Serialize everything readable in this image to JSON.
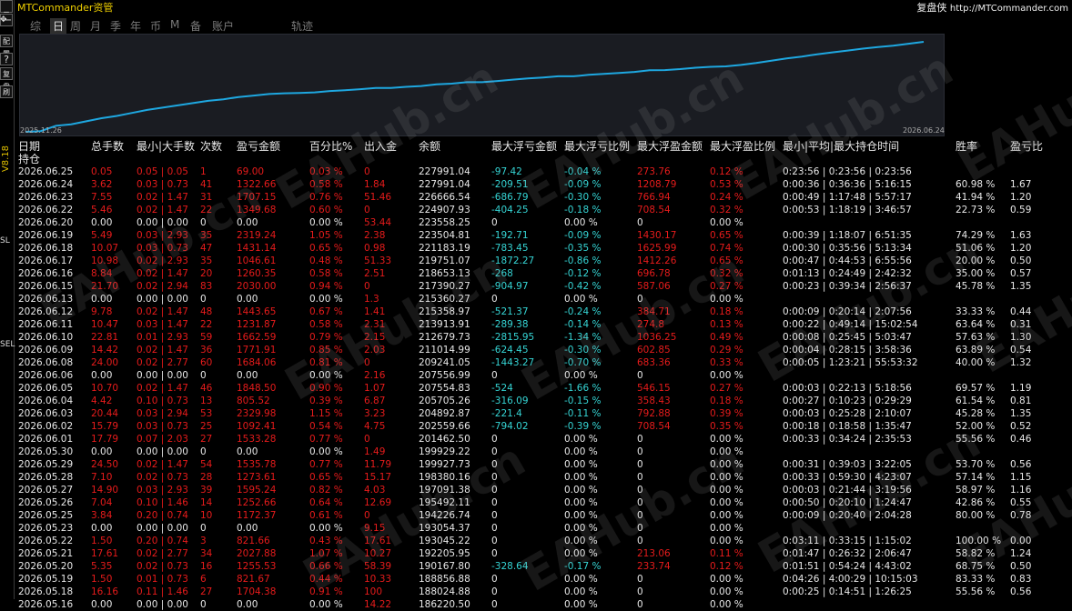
{
  "app": {
    "title": "MTCommander资管",
    "brand": "复盘侠",
    "url": "http://MTCommander.com",
    "version": "V8.18"
  },
  "left_toolbar": [
    "_",
    "一",
    "✥",
    "配置",
    "?",
    "复盘",
    "刷",
    "SL",
    "SEL"
  ],
  "tabs": [
    {
      "label": "综",
      "active": false
    },
    {
      "label": "日",
      "active": true
    },
    {
      "label": "周",
      "active": false
    },
    {
      "label": "月",
      "active": false
    },
    {
      "label": "季",
      "active": false
    },
    {
      "label": "年",
      "active": false
    },
    {
      "label": "币",
      "active": false
    },
    {
      "label": "M",
      "active": false
    },
    {
      "label": "备",
      "active": false
    },
    {
      "label": "账户",
      "active": false
    },
    {
      "label": "轨迹",
      "active": false
    }
  ],
  "chart": {
    "start_label": "2025.11.26",
    "end_label": "2026.06.24",
    "line_color": "#1ea7e0",
    "values": [
      142000,
      143000,
      150000,
      152000,
      156000,
      160000,
      163000,
      167000,
      171000,
      174000,
      177000,
      180000,
      183000,
      185000,
      188000,
      190000,
      192000,
      193000,
      193500,
      194200,
      196000,
      197000,
      198400,
      199900,
      199900,
      201500,
      202600,
      204900,
      205700,
      207600,
      207600,
      209200,
      211000,
      212700,
      213900,
      215400,
      215400,
      217400,
      218700,
      219800,
      221200,
      223500,
      223600,
      224900,
      226700,
      227990,
      228500,
      230500,
      233000,
      236000,
      239000,
      241500,
      244500,
      247000,
      249500,
      252000,
      254000,
      256000,
      258500,
      261000
    ]
  },
  "watermark": "EAHub.cn",
  "table": {
    "headers": [
      "日期",
      "总手数",
      "最小|大手数",
      "次数",
      "盈亏金额",
      "百分比%",
      "出入金",
      "余额",
      "最大浮亏金额",
      "最大浮亏比例",
      "最大浮盈金额",
      "最大浮盈比例",
      "最小|平均|最大持仓时间",
      "胜率",
      "盈亏比"
    ],
    "sub_header": "持仓",
    "rows": [
      [
        "2026.06.25",
        "0.05",
        "0.05 | 0.05",
        "1",
        "69.00",
        "0.03 %",
        "0",
        "227991.04",
        "-97.42",
        "-0.04 %",
        "273.76",
        "0.12 %",
        "0:23:56 | 0:23:56 | 0:23:56",
        "",
        ""
      ],
      [
        "2026.06.24",
        "3.62",
        "0.03 | 0.73",
        "41",
        "1322.66",
        "0.58 %",
        "1.84",
        "227991.04",
        "-209.51",
        "-0.09 %",
        "1208.79",
        "0.53 %",
        "0:00:36 | 0:36:36 | 5:16:15",
        "60.98 %",
        "1.67"
      ],
      [
        "2026.06.23",
        "7.55",
        "0.02 | 1.47",
        "31",
        "1707.15",
        "0.76 %",
        "51.46",
        "226666.54",
        "-686.79",
        "-0.30 %",
        "766.94",
        "0.24 %",
        "0:00:49 | 1:17:48 | 5:57:17",
        "41.94 %",
        "1.20"
      ],
      [
        "2026.06.22",
        "5.46",
        "0.02 | 1.47",
        "22",
        "1349.68",
        "0.60 %",
        "0",
        "224907.93",
        "-404.25",
        "-0.18 %",
        "708.54",
        "0.32 %",
        "0:00:53 | 1:18:19 | 3:46:57",
        "22.73 %",
        "0.59"
      ],
      [
        "2026.06.20",
        "0.00",
        "0.00 | 0.00",
        "0",
        "0.00",
        "0.00 %",
        "53.44",
        "223558.25",
        "0",
        "0.00 %",
        "0",
        "0.00 %",
        "",
        "",
        ""
      ],
      [
        "2026.06.19",
        "5.49",
        "0.03 | 2.93",
        "35",
        "2319.24",
        "1.05 %",
        "2.38",
        "223504.81",
        "-192.71",
        "-0.09 %",
        "1430.17",
        "0.65 %",
        "0:00:39 | 1:18:07 | 6:51:35",
        "74.29 %",
        "1.63"
      ],
      [
        "2026.06.18",
        "10.07",
        "0.03 | 0.73",
        "47",
        "1431.14",
        "0.65 %",
        "0.98",
        "221183.19",
        "-783.45",
        "-0.35 %",
        "1625.99",
        "0.74 %",
        "0:00:30 | 0:35:56 | 5:13:34",
        "51.06 %",
        "1.20"
      ],
      [
        "2026.06.17",
        "10.98",
        "0.02 | 2.93",
        "35",
        "1046.61",
        "0.48 %",
        "51.33",
        "219751.07",
        "-1872.27",
        "-0.86 %",
        "1412.26",
        "0.65 %",
        "0:00:47 | 0:44:53 | 6:55:56",
        "20.00 %",
        "0.50"
      ],
      [
        "2026.06.16",
        "8.84",
        "0.02 | 1.47",
        "20",
        "1260.35",
        "0.58 %",
        "2.51",
        "218653.13",
        "-268",
        "-0.12 %",
        "696.78",
        "0.32 %",
        "0:01:13 | 0:24:49 | 2:42:32",
        "35.00 %",
        "0.57"
      ],
      [
        "2026.06.15",
        "21.70",
        "0.02 | 2.94",
        "83",
        "2030.00",
        "0.94 %",
        "0",
        "217390.27",
        "-904.97",
        "-0.42 %",
        "587.06",
        "0.27 %",
        "0:00:23 | 0:39:34 | 2:56:37",
        "45.78 %",
        "1.35"
      ],
      [
        "2026.06.13",
        "0.00",
        "0.00 | 0.00",
        "0",
        "0.00",
        "0.00 %",
        "1.3",
        "215360.27",
        "0",
        "0.00 %",
        "0",
        "0.00 %",
        "",
        "",
        ""
      ],
      [
        "2026.06.12",
        "9.78",
        "0.02 | 1.47",
        "48",
        "1443.65",
        "0.67 %",
        "1.41",
        "215358.97",
        "-521.37",
        "-0.24 %",
        "384.71",
        "0.18 %",
        "0:00:09 | 0:20:14 | 2:07:56",
        "33.33 %",
        "0.44"
      ],
      [
        "2026.06.11",
        "10.47",
        "0.03 | 1.47",
        "22",
        "1231.87",
        "0.58 %",
        "2.31",
        "213913.91",
        "-289.38",
        "-0.14 %",
        "274.8",
        "0.13 %",
        "0:00:22 | 0:49:14 | 15:02:54",
        "63.64 %",
        "0.31"
      ],
      [
        "2026.06.10",
        "22.81",
        "0.01 | 2.93",
        "59",
        "1662.59",
        "0.79 %",
        "2.15",
        "212679.73",
        "-2815.95",
        "-1.34 %",
        "1036.25",
        "0.49 %",
        "0:00:08 | 0:25:45 | 5:03:47",
        "57.63 %",
        "1.30"
      ],
      [
        "2026.06.09",
        "14.42",
        "0.02 | 1.47",
        "36",
        "1771.91",
        "0.85 %",
        "2.03",
        "211014.99",
        "-624.45",
        "-0.30 %",
        "602.85",
        "0.29 %",
        "0:00:04 | 0:28:15 | 3:58:36",
        "63.89 %",
        "0.54"
      ],
      [
        "2026.06.08",
        "24.00",
        "0.02 | 2.77",
        "60",
        "1684.06",
        "0.81 %",
        "0",
        "209241.05",
        "-1443.27",
        "-0.70 %",
        "683.36",
        "0.33 %",
        "0:00:05 | 1:23:21 | 55:53:32",
        "40.00 %",
        "1.32"
      ],
      [
        "2026.06.06",
        "0.00",
        "0.00 | 0.00",
        "0",
        "0.00",
        "0.00 %",
        "2.16",
        "207556.99",
        "0",
        "0.00 %",
        "0",
        "0.00 %",
        "",
        "",
        ""
      ],
      [
        "2026.06.05",
        "10.70",
        "0.02 | 1.47",
        "46",
        "1848.50",
        "0.90 %",
        "1.07",
        "207554.83",
        "-524",
        "-1.66 %",
        "546.15",
        "0.27 %",
        "0:00:03 | 0:22:13 | 5:18:56",
        "69.57 %",
        "1.19"
      ],
      [
        "2026.06.04",
        "4.42",
        "0.10 | 0.73",
        "13",
        "805.52",
        "0.39 %",
        "6.87",
        "205705.26",
        "-316.09",
        "-0.15 %",
        "358.43",
        "0.18 %",
        "0:00:27 | 0:10:23 | 0:29:29",
        "61.54 %",
        "0.81"
      ],
      [
        "2026.06.03",
        "20.44",
        "0.03 | 2.94",
        "53",
        "2329.98",
        "1.15 %",
        "3.23",
        "204892.87",
        "-221.4",
        "-0.11 %",
        "792.88",
        "0.39 %",
        "0:00:03 | 0:25:28 | 2:10:07",
        "45.28 %",
        "1.35"
      ],
      [
        "2026.06.02",
        "15.79",
        "0.03 | 0.73",
        "25",
        "1092.41",
        "0.54 %",
        "4.75",
        "202559.66",
        "-794.02",
        "-0.39 %",
        "708.54",
        "0.35 %",
        "0:00:18 | 0:18:58 | 1:35:47",
        "52.00 %",
        "0.52"
      ],
      [
        "2026.06.01",
        "17.79",
        "0.07 | 2.03",
        "27",
        "1533.28",
        "0.77 %",
        "0",
        "201462.50",
        "0",
        "0.00 %",
        "0",
        "0.00 %",
        "0:00:33 | 0:34:24 | 2:35:53",
        "55.56 %",
        "0.46"
      ],
      [
        "2026.05.30",
        "0.00",
        "0.00 | 0.00",
        "0",
        "0.00",
        "0.00 %",
        "1.49",
        "199929.22",
        "0",
        "0.00 %",
        "0",
        "0.00 %",
        "",
        "",
        ""
      ],
      [
        "2026.05.29",
        "24.50",
        "0.02 | 1.47",
        "54",
        "1535.78",
        "0.77 %",
        "11.79",
        "199927.73",
        "0",
        "0.00 %",
        "0",
        "0.00 %",
        "0:00:31 | 0:39:03 | 3:22:05",
        "53.70 %",
        "0.56"
      ],
      [
        "2026.05.28",
        "7.10",
        "0.02 | 0.73",
        "28",
        "1273.61",
        "0.65 %",
        "15.17",
        "198380.16",
        "0",
        "0.00 %",
        "0",
        "0.00 %",
        "0:00:33 | 0:59:30 | 4:23:07",
        "57.14 %",
        "1.15"
      ],
      [
        "2026.05.27",
        "14.90",
        "0.03 | 2.93",
        "39",
        "1595.24",
        "0.82 %",
        "4.03",
        "197091.38",
        "0",
        "0.00 %",
        "0",
        "0.00 %",
        "0:00:03 | 0:21:44 | 3:19:56",
        "58.97 %",
        "1.16"
      ],
      [
        "2026.05.26",
        "7.04",
        "0.10 | 1.46",
        "14",
        "1252.66",
        "0.64 %",
        "12.69",
        "195492.11",
        "0",
        "0.00 %",
        "0",
        "0.00 %",
        "0:00:50 | 0:20:10 | 1:24:47",
        "42.86 %",
        "0.55"
      ],
      [
        "2026.05.25",
        "3.84",
        "0.20 | 0.74",
        "10",
        "1172.37",
        "0.61 %",
        "0",
        "194226.74",
        "0",
        "0.00 %",
        "0",
        "0.00 %",
        "0:00:09 | 0:20:40 | 2:04:28",
        "80.00 %",
        "0.78"
      ],
      [
        "2026.05.23",
        "0.00",
        "0.00 | 0.00",
        "0",
        "0.00",
        "0.00 %",
        "9.15",
        "193054.37",
        "0",
        "0.00 %",
        "0",
        "0.00 %",
        "",
        "",
        ""
      ],
      [
        "2026.05.22",
        "1.50",
        "0.20 | 0.74",
        "3",
        "821.66",
        "0.43 %",
        "17.61",
        "193045.22",
        "0",
        "0.00 %",
        "0",
        "0.00 %",
        "0:03:11 | 0:33:15 | 1:15:02",
        "100.00 %",
        "0.00"
      ],
      [
        "2026.05.21",
        "17.61",
        "0.02 | 2.77",
        "34",
        "2027.88",
        "1.07 %",
        "10.27",
        "192205.95",
        "0",
        "0.00 %",
        "213.06",
        "0.11 %",
        "0:01:47 | 0:26:32 | 2:06:47",
        "58.82 %",
        "1.24"
      ],
      [
        "2026.05.20",
        "5.35",
        "0.02 | 0.73",
        "16",
        "1255.53",
        "0.66 %",
        "58.39",
        "190167.80",
        "-328.64",
        "-0.17 %",
        "233.74",
        "0.12 %",
        "0:01:51 | 0:54:24 | 4:43:02",
        "68.75 %",
        "0.50"
      ],
      [
        "2026.05.19",
        "1.50",
        "0.01 | 0.73",
        "6",
        "821.67",
        "0.44 %",
        "10.33",
        "188856.88",
        "0",
        "0.00 %",
        "0",
        "0.00 %",
        "0:04:26 | 4:00:29 | 10:15:03",
        "83.33 %",
        "0.83"
      ],
      [
        "2026.05.18",
        "16.16",
        "0.11 | 1.46",
        "27",
        "1704.38",
        "0.91 %",
        "100",
        "188024.88",
        "0",
        "0.00 %",
        "0",
        "0.00 %",
        "0:00:25 | 0:14:51 | 1:26:25",
        "55.56 %",
        "0.56"
      ],
      [
        "2026.05.16",
        "0.00",
        "0.00 | 0.00",
        "0",
        "0.00",
        "0.00 %",
        "14.22",
        "186220.50",
        "0",
        "0.00 %",
        "0",
        "0.00 %",
        "",
        "",
        ""
      ]
    ]
  }
}
